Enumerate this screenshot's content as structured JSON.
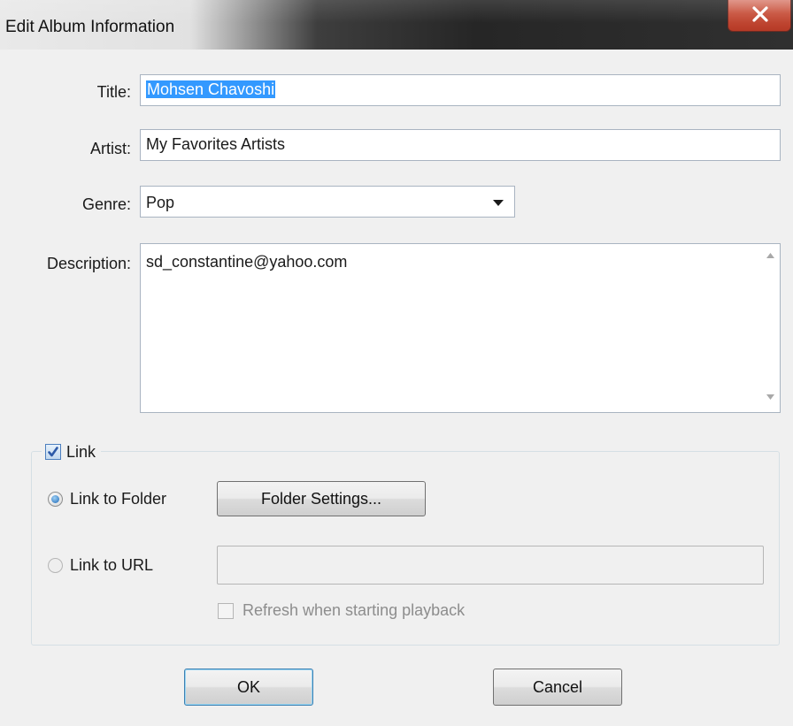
{
  "window": {
    "title": "Edit Album Information"
  },
  "fields": {
    "title_label": "Title:",
    "title_value": "Mohsen Chavoshi",
    "artist_label": "Artist:",
    "artist_value": "My Favorites Artists",
    "genre_label": "Genre:",
    "genre_value": "Pop",
    "description_label": "Description:",
    "description_value": "sd_constantine@yahoo.com"
  },
  "link_group": {
    "link_label": "Link",
    "link_checked": true,
    "link_to_folder_label": "Link to Folder",
    "link_to_folder_selected": true,
    "folder_settings_label": "Folder Settings...",
    "link_to_url_label": "Link to URL",
    "url_value": "",
    "refresh_label": "Refresh when starting playback"
  },
  "buttons": {
    "ok_label": "OK",
    "cancel_label": "Cancel"
  }
}
